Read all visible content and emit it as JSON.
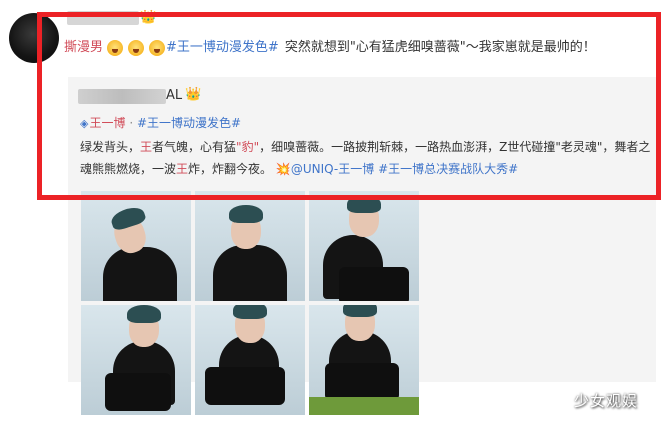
{
  "post": {
    "tag_user": "撕漫男",
    "hashtag": "#王一博动漫发色#",
    "text": "突然就想到\"心有猛虎细嗅蔷薇\"～我家崽就是最帅的！",
    "emoji_icons": [
      "grinning-face-icon",
      "grinning-face-icon",
      "grinning-face-icon"
    ]
  },
  "repost": {
    "user_suffix": "AL",
    "super_topic": "王一博",
    "separator": "·",
    "hashtag": "#王一博动漫发色#",
    "body_part1": "绿发背头，",
    "body_red1": "王",
    "body_part2": "者气魄，心有猛",
    "body_red2": "\"豹\"",
    "body_part3": "，细嗅蔷薇。一路披荆斩棘，一路热血澎湃，Z世代碰撞\"老灵魂\"，舞者之魂熊熊燃烧，一波",
    "body_red3": "王",
    "body_part4": "炸，炸翻今夜。",
    "mention": "@UNIQ-王一博",
    "hashtag2": "#王一博总决赛战队大秀#"
  },
  "watermark": "少女观娱",
  "colors": {
    "highlight_border": "#ec2226",
    "link_blue": "#3f74c9",
    "tag_red": "#d14b58",
    "repost_bg": "#f4f4f4"
  }
}
